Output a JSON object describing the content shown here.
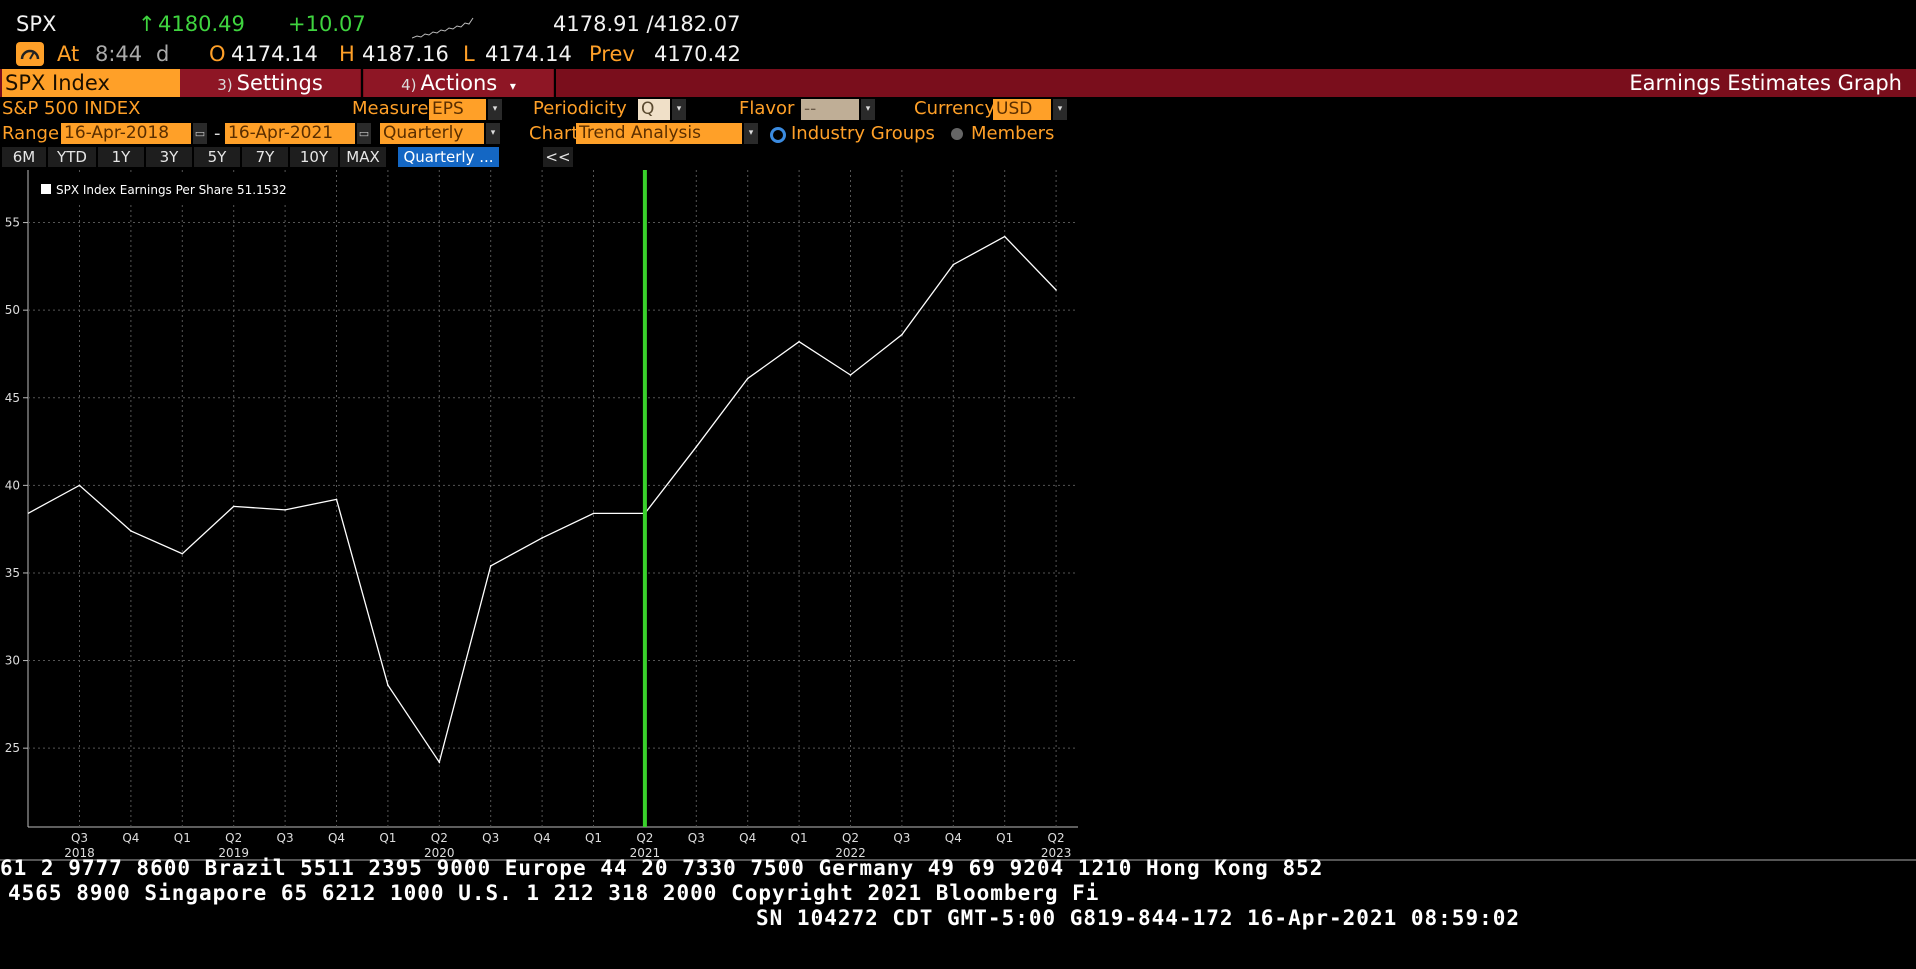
{
  "quote": {
    "symbol": "SPX",
    "arrow": "↑",
    "last": "4180.49",
    "change": "+10.07",
    "bid_ask": "4178.91 /4182.07",
    "at_label": "At",
    "time": "8:44",
    "time_suffix": "d",
    "open_label": "O",
    "open": "4174.14",
    "high_label": "H",
    "high": "4187.16",
    "low_label": "L",
    "low": "4174.14",
    "prev_label": "Prev",
    "prev": "4170.42"
  },
  "toolbar": {
    "security": "SPX Index",
    "settings_num": "3)",
    "settings_label": "Settings",
    "actions_num": "4)",
    "actions_label": "Actions",
    "actions_arrow": "▾",
    "screen_title": "Earnings Estimates Graph"
  },
  "controls": {
    "index_name": "S&P 500 INDEX",
    "measure_label": "Measure",
    "measure_value": "EPS",
    "periodicity_label": "Periodicity",
    "periodicity_value": "Q",
    "flavor_label": "Flavor",
    "flavor_value": "--",
    "currency_label": "Currency",
    "currency_value": "USD",
    "range_label": "Range",
    "range_start": "16-Apr-2018",
    "range_dash": "-",
    "range_end": "16-Apr-2021",
    "range_period": "Quarterly",
    "chart_label": "Chart",
    "chart_value": "Trend Analysis",
    "industry_groups": "Industry Groups",
    "members": "Members",
    "dropdown_glyph": "▾",
    "calendar_glyph": "▭",
    "collapse": "<<"
  },
  "range_buttons": [
    "6M",
    "YTD",
    "1Y",
    "3Y",
    "5Y",
    "7Y",
    "10Y",
    "MAX",
    "Quarterly ..."
  ],
  "colors": {
    "background": "#000000",
    "accent_orange": "#ffa028",
    "toolbar_red": "#7a0e1c",
    "positive_green": "#3fd43f",
    "today_marker": "#39d12b",
    "series_line": "#ffffff",
    "grid": "#555555",
    "active_button": "#1467c4"
  },
  "chart_data": {
    "type": "line",
    "legend_text": "SPX Index Earnings Per Share 51.1532",
    "quarter_labels": [
      "Q3",
      "Q4",
      "Q1",
      "Q2",
      "Q3",
      "Q4",
      "Q1",
      "Q2",
      "Q3",
      "Q4",
      "Q1",
      "Q2",
      "Q3",
      "Q4",
      "Q1",
      "Q2",
      "Q3",
      "Q4",
      "Q1",
      "Q2"
    ],
    "year_labels": [
      {
        "year": "2018",
        "at_index": 0
      },
      {
        "year": "2019",
        "at_index": 3
      },
      {
        "year": "2020",
        "at_index": 7
      },
      {
        "year": "2021",
        "at_index": 11
      },
      {
        "year": "2022",
        "at_index": 15
      },
      {
        "year": "2023",
        "at_index": 19
      }
    ],
    "series": [
      {
        "name": "SPX Index Earnings Per Share",
        "start_value": 38.4,
        "values": [
          40.0,
          37.4,
          36.1,
          38.8,
          38.6,
          39.2,
          28.6,
          24.2,
          35.4,
          37.0,
          38.4,
          38.4,
          42.2,
          46.1,
          48.2,
          46.3,
          48.6,
          52.6,
          54.2,
          51.15
        ]
      }
    ],
    "today_index": 11,
    "yticks": [
      25,
      30,
      35,
      40,
      45,
      50,
      55
    ],
    "ylim": [
      20.5,
      58
    ],
    "grid": true,
    "legend_position": "top-left"
  },
  "footer": {
    "line1": "61 2 9777 8600 Brazil 5511 2395 9000 Europe 44 20 7330 7500 Germany 49 69 9204 1210 Hong Kong 852",
    "line2": "4565 8900       Singapore 65 6212 1000      U.S. 1 212 318 2000       Copyright 2021 Bloomberg Fi",
    "line3": "SN 104272 CDT  GMT-5:00 G819-844-172 16-Apr-2021 08:59:02"
  }
}
